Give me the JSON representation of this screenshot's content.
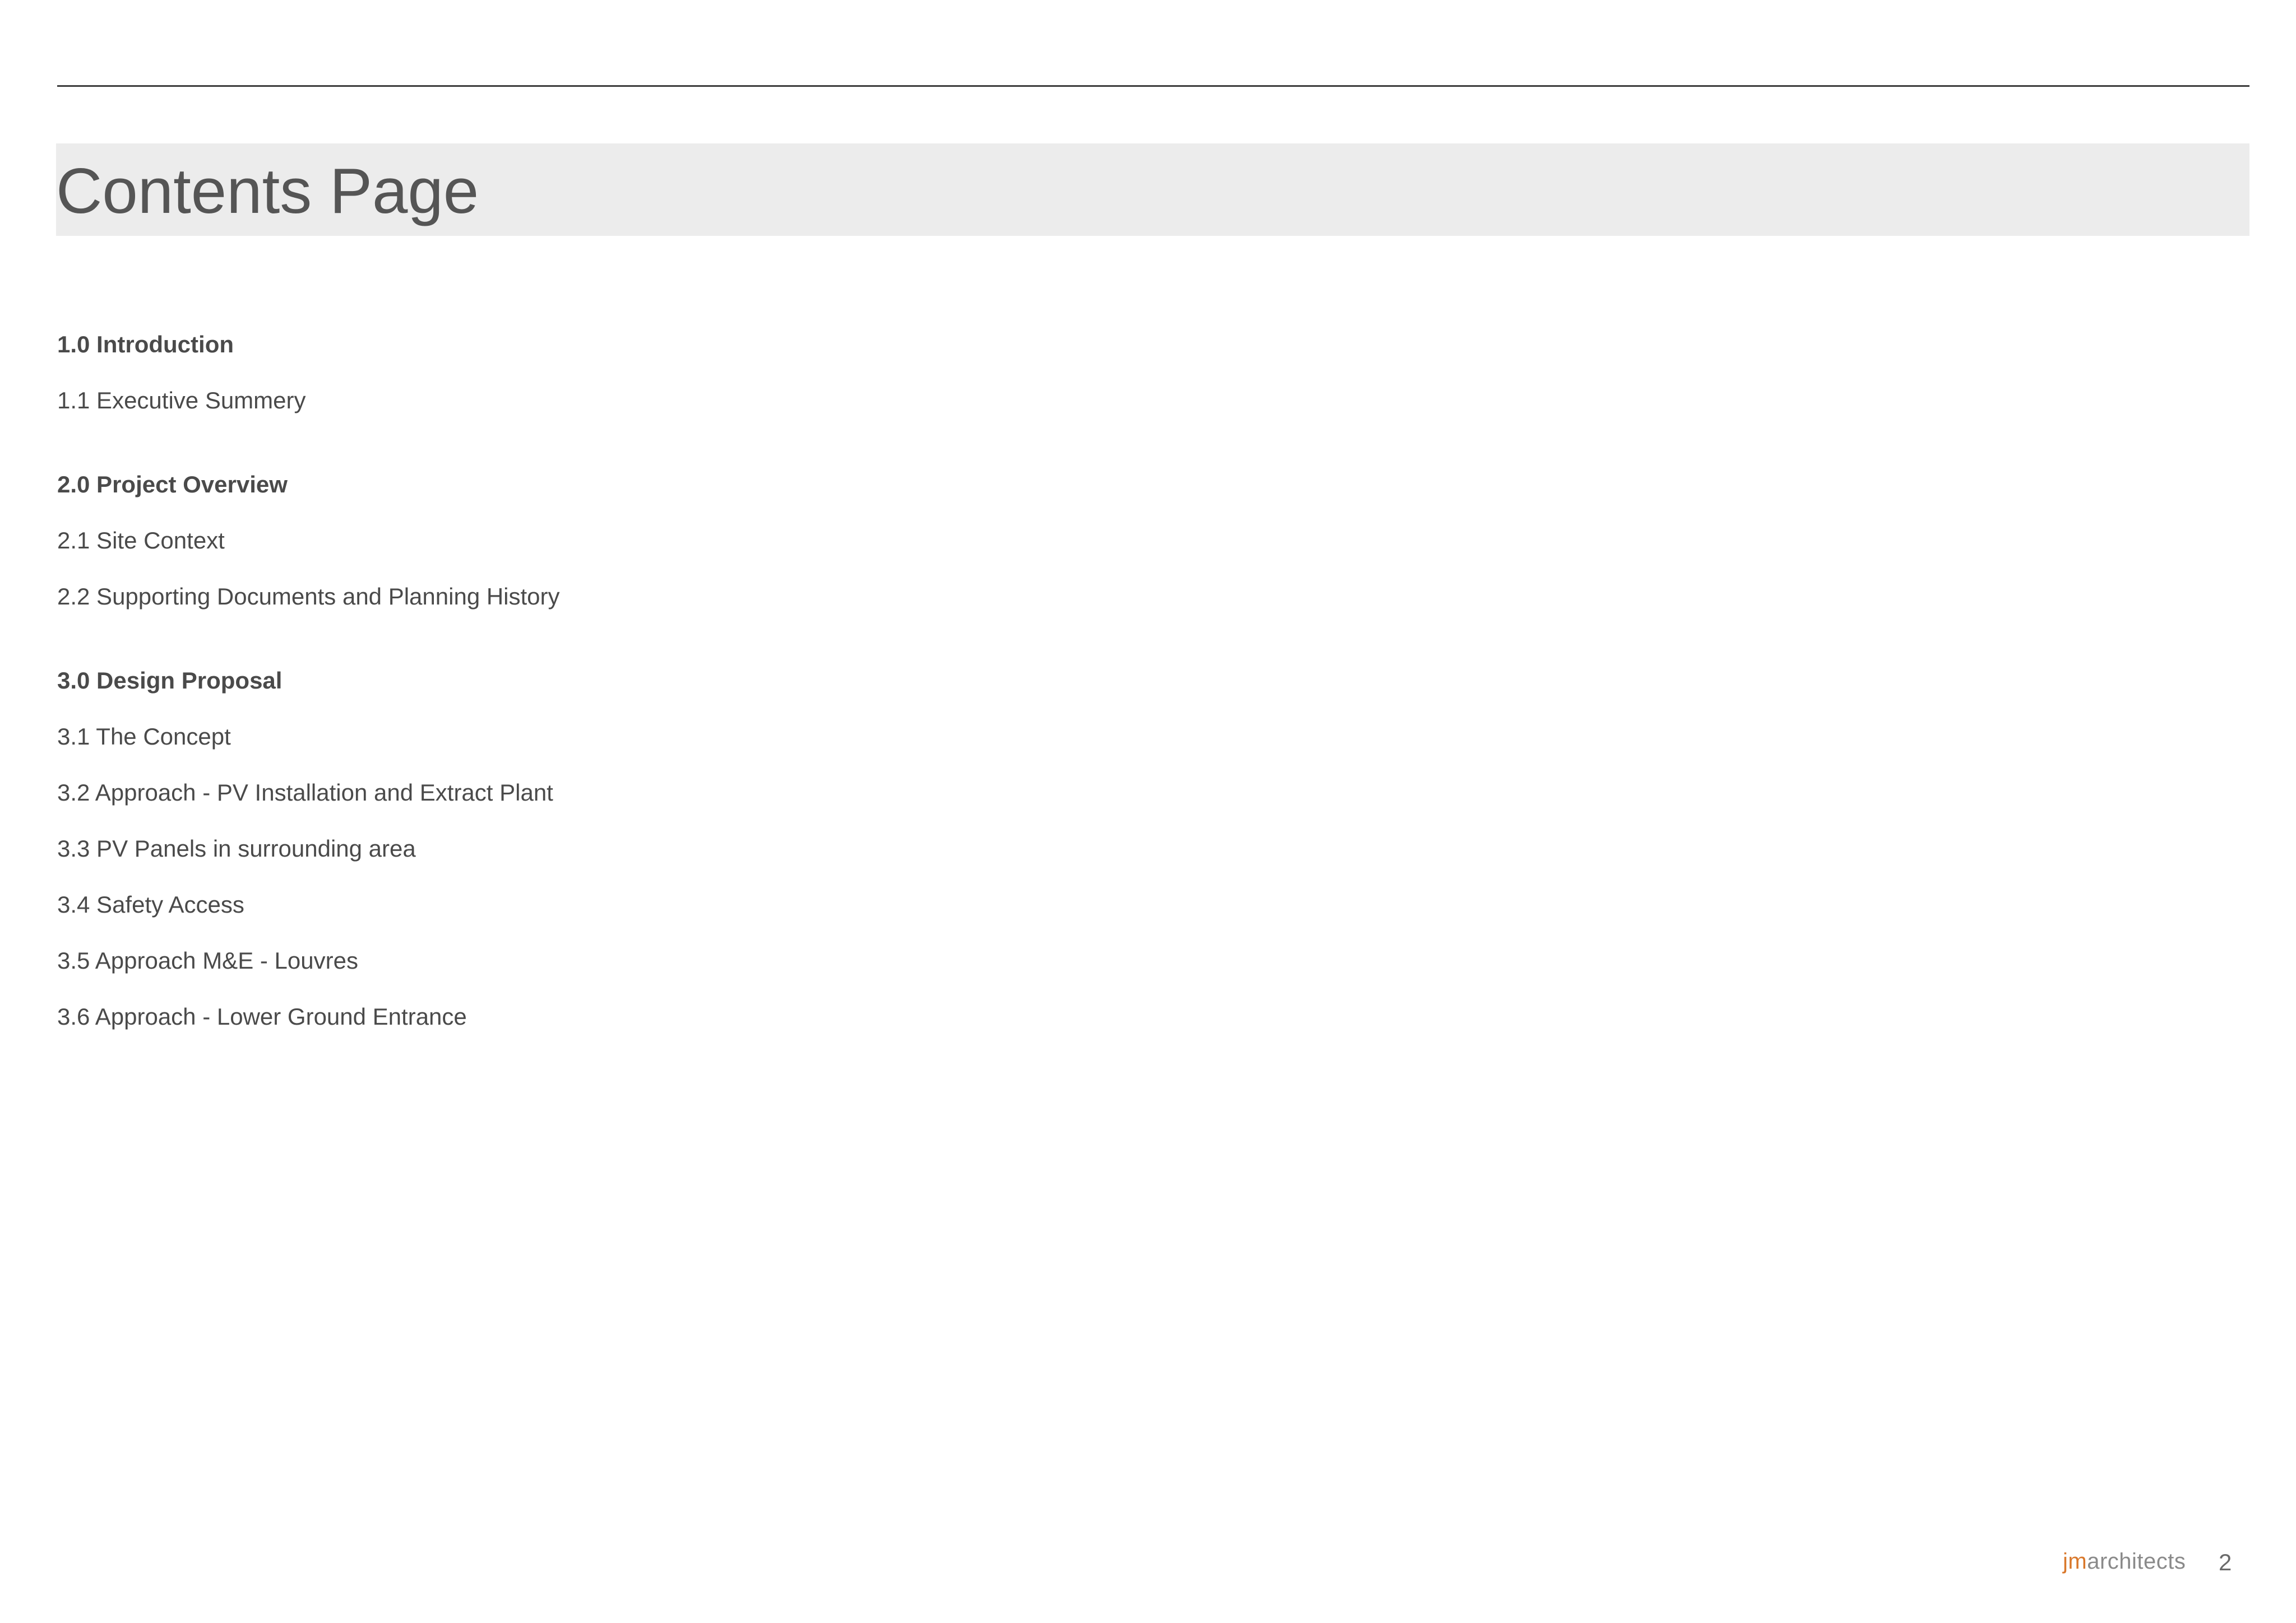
{
  "page": {
    "title": "Contents Page",
    "page_number": "2"
  },
  "toc": {
    "entries": [
      {
        "label": "1.0 Introduction",
        "type": "section"
      },
      {
        "label": "1.1 Executive Summery",
        "type": "item"
      },
      {
        "label": "2.0 Project Overview",
        "type": "section"
      },
      {
        "label": "2.1 Site Context",
        "type": "item"
      },
      {
        "label": "2.2 Supporting Documents and Planning History",
        "type": "item"
      },
      {
        "label": "3.0 Design Proposal",
        "type": "section"
      },
      {
        "label": "3.1 The Concept",
        "type": "item"
      },
      {
        "label": "3.2 Approach - PV Installation and Extract Plant",
        "type": "item"
      },
      {
        "label": "3.3 PV Panels in surrounding area",
        "type": "item"
      },
      {
        "label": "3.4 Safety Access",
        "type": "item"
      },
      {
        "label": "3.5 Approach M&E - Louvres",
        "type": "item"
      },
      {
        "label": "3.6 Approach - Lower Ground Entrance",
        "type": "item"
      }
    ]
  },
  "footer": {
    "logo_prefix": "jm",
    "logo_suffix": "architects"
  },
  "colors": {
    "title_band": "#ececec",
    "text": "#4a4a4a",
    "logo_accent": "#d9782b",
    "logo_text": "#8a8a8a"
  }
}
